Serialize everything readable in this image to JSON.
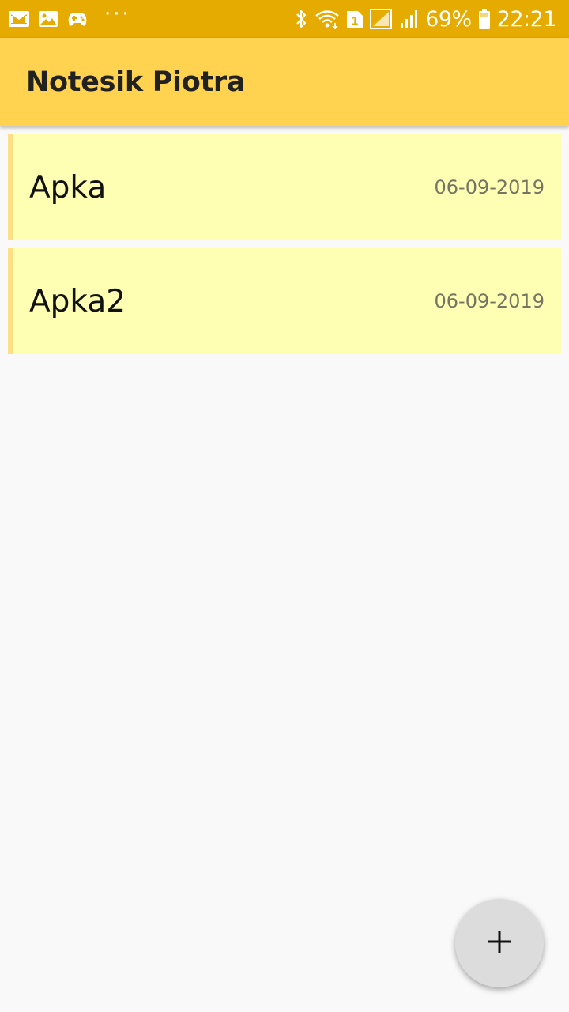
{
  "status_bar": {
    "battery": "69%",
    "time": "22:21",
    "sim_slot": "1",
    "more_dots": "···",
    "left_icons": [
      "mail-icon",
      "gallery-icon",
      "game-controller-icon"
    ],
    "right_icons": [
      "bluetooth-icon",
      "wifi-icon",
      "sim-icon",
      "signal-icon",
      "battery-icon"
    ]
  },
  "app_bar": {
    "title": "Notesik Piotra",
    "color": "#ffd24f"
  },
  "notes": [
    {
      "title": "Apka",
      "date": "06-09-2019"
    },
    {
      "title": "Apka2",
      "date": "06-09-2019"
    }
  ],
  "fab": {
    "icon": "plus-icon"
  },
  "colors": {
    "status_bar": "#e6ab00",
    "card_background": "#ffffb3",
    "card_accent": "#ffdf85",
    "background": "#f9f9f9"
  }
}
